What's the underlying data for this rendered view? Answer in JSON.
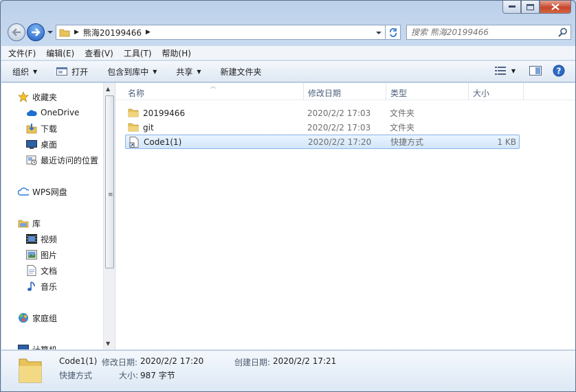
{
  "address": {
    "crumb": "熊海20199466",
    "search_placeholder": "搜索 熊海20199466"
  },
  "menu": [
    "文件(F)",
    "编辑(E)",
    "查看(V)",
    "工具(T)",
    "帮助(H)"
  ],
  "commands": {
    "organize": "组织",
    "open": "打开",
    "include_in_library": "包含到库中",
    "share": "共享",
    "new_folder": "新建文件夹"
  },
  "nav": {
    "favorites": "收藏夹",
    "onedrive": "OneDrive",
    "downloads": "下载",
    "desktop": "桌面",
    "recent": "最近访问的位置",
    "wps": "WPS网盘",
    "libraries": "库",
    "videos": "视频",
    "pictures": "图片",
    "documents": "文档",
    "music": "音乐",
    "homegroup": "家庭组",
    "computer": "计算机"
  },
  "columns": {
    "name": "名称",
    "date": "修改日期",
    "type": "类型",
    "size": "大小"
  },
  "files": [
    {
      "name": "20199466",
      "date": "2020/2/2 17:03",
      "type": "文件夹",
      "size": ""
    },
    {
      "name": "git",
      "date": "2020/2/2 17:03",
      "type": "文件夹",
      "size": ""
    },
    {
      "name": "Code1(1)",
      "date": "2020/2/2 17:20",
      "type": "快捷方式",
      "size": "1 KB"
    }
  ],
  "details": {
    "name": "Code1(1)",
    "modified_label": "修改日期:",
    "modified": "2020/2/2 17:20",
    "created_label": "创建日期:",
    "created": "2020/2/2 17:21",
    "type": "快捷方式",
    "size_label": "大小:",
    "size": "987 字节"
  },
  "colors": {
    "selection": "#d2e6fc",
    "selection_border": "#86b3e6",
    "folder": "#e8c25a"
  }
}
